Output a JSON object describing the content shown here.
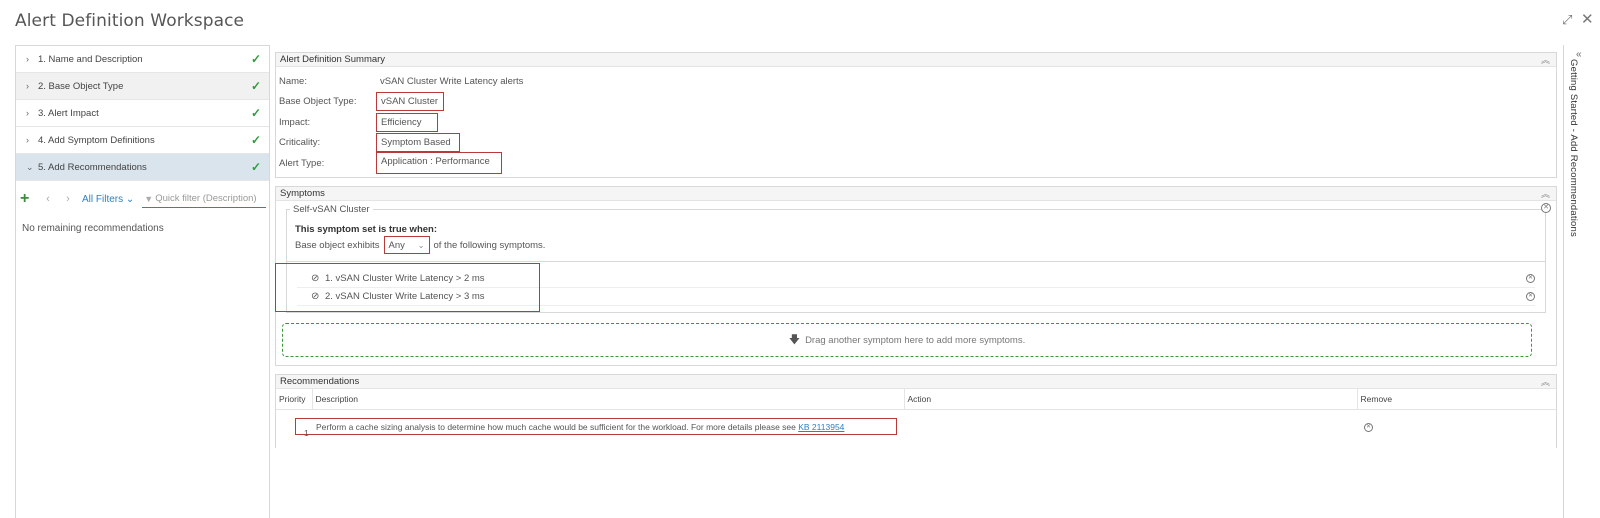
{
  "window": {
    "title": "Alert Definition Workspace",
    "expand_icon": "⤢",
    "close_icon": "✕"
  },
  "steps": [
    {
      "label": "1. Name and Description",
      "chev": "›"
    },
    {
      "label": "2. Base Object Type",
      "chev": "›"
    },
    {
      "label": "3. Alert Impact",
      "chev": "›"
    },
    {
      "label": "4. Add Symptom Definitions",
      "chev": "›"
    },
    {
      "label": "5. Add Recommendations",
      "chev": "⌄"
    }
  ],
  "toolbar": {
    "add": "+",
    "prev": "‹",
    "next": "›",
    "all_filters": "All Filters ⌄",
    "quick_filter_placeholder": "Quick filter (Description)"
  },
  "left_empty": "No remaining recommendations",
  "summary": {
    "header": "Alert Definition Summary",
    "name_label": "Name:",
    "name_value": "vSAN Cluster Write Latency alerts",
    "base_label": "Base Object Type:",
    "base_value": "vSAN Cluster",
    "impact_label": "Impact:",
    "impact_value": "Efficiency",
    "criticality_label": "Criticality:",
    "criticality_value": "Symptom Based",
    "alert_type_label": "Alert Type:",
    "alert_type_value": "Application : Performance"
  },
  "symptoms": {
    "header": "Symptoms",
    "set_legend": "Self-vSAN Cluster",
    "rule_heading": "This symptom set is true when:",
    "rule_prefix": "Base object exhibits",
    "rule_any": "Any",
    "rule_suffix": "of the following symptoms.",
    "items": [
      "1. vSAN Cluster Write Latency > 2 ms",
      "2. vSAN Cluster Write Latency > 3 ms"
    ],
    "drop_hint": "Drag another symptom here to add more symptoms."
  },
  "recommendations": {
    "header": "Recommendations",
    "columns": {
      "priority": "Priority",
      "description": "Description",
      "action": "Action",
      "remove": "Remove"
    },
    "rows": [
      {
        "priority": "1",
        "description": "Perform a cache sizing analysis to determine how much cache would be sufficient for the workload. For more details please see ",
        "link": "KB 2113954"
      }
    ]
  },
  "side_panel": {
    "label": "Getting Started - Add Recommendations",
    "chev": "«"
  },
  "colors": {
    "accent": "#2f7fc1",
    "check": "#2e9c3e",
    "highlight_box": "#b93a3a",
    "drop_border": "#3a9a3a"
  }
}
